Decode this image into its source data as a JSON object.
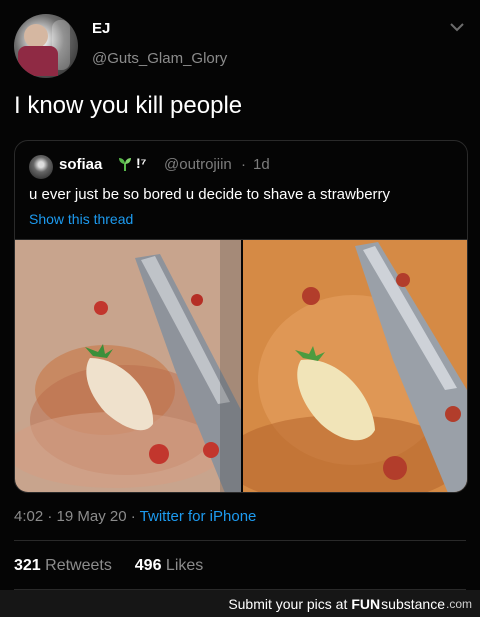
{
  "user": {
    "display_name": "EJ",
    "handle": "@Guts_Glam_Glory"
  },
  "tweet": {
    "text": "I know you kill people",
    "time": "4:02",
    "date": "19 May 20",
    "meta_sep": "·",
    "source": "Twitter for iPhone",
    "retweets": "321",
    "retweets_label": "Retweets",
    "likes": "496",
    "likes_label": "Likes"
  },
  "quote": {
    "name": "sofiaa",
    "emoji": "!⁷",
    "handle": "@outrojiin",
    "sep": "·",
    "time": "1d",
    "text": "u ever just be so bored u decide to shave a strawberry",
    "thread_link": "Show this thread"
  },
  "footer": {
    "prefix": "Submit your pics at",
    "brand_bold": "FUN",
    "brand_rest": "substance",
    "domain": ".com"
  },
  "colors": {
    "link": "#1d9bf0",
    "background": "#000000",
    "muted": "#8c8c8c"
  },
  "icons": {
    "more": "chevron-down-icon",
    "sprout": "seedling-icon"
  }
}
